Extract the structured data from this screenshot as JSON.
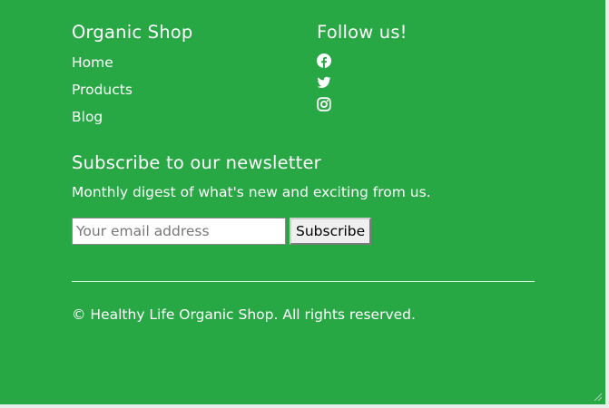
{
  "brand": {
    "title": "Organic Shop"
  },
  "nav": {
    "items": [
      {
        "label": "Home"
      },
      {
        "label": "Products"
      },
      {
        "label": "Blog"
      }
    ]
  },
  "social": {
    "title": "Follow us!",
    "icons": [
      "facebook-icon",
      "twitter-icon",
      "instagram-icon"
    ]
  },
  "newsletter": {
    "title": "Subscribe to our newsletter",
    "description": "Monthly digest of what's new and exciting from us.",
    "email_placeholder": "Your email address",
    "email_value": "",
    "button_label": "Subscribe"
  },
  "footer": {
    "copyright": "© Healthy Life Organic Shop. All rights reserved."
  },
  "colors": {
    "background": "#28a745",
    "text": "#ffffff"
  }
}
